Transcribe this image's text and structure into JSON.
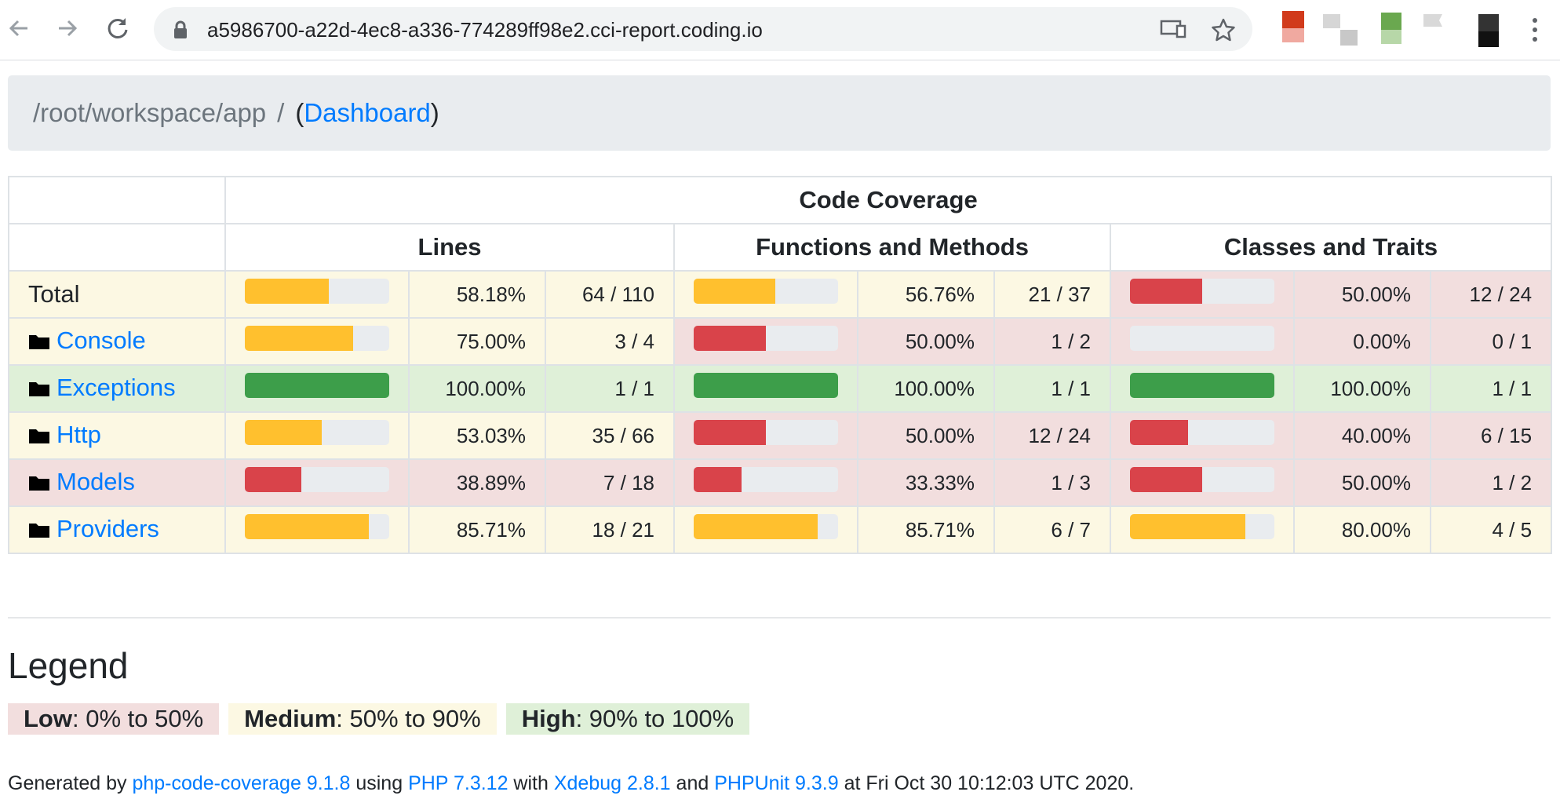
{
  "browser": {
    "url": "a5986700-a22d-4ec8-a336-774289ff98e2.cci-report.coding.io",
    "icons": [
      "back-arrow-icon",
      "forward-arrow-icon",
      "reload-icon",
      "lock-icon",
      "cast-icon",
      "star-icon",
      "menu-icon"
    ]
  },
  "breadcrumb": {
    "path": "/root/workspace/app",
    "separator": "/",
    "open_paren": "(",
    "dashboard": "Dashboard",
    "close_paren": ")"
  },
  "table": {
    "group_header": "Code Coverage",
    "headers": {
      "lines": "Lines",
      "functions": "Functions and Methods",
      "classes": "Classes and Traits"
    },
    "rows": [
      {
        "name": "Total",
        "link": false,
        "lines": {
          "level": "warning",
          "pct": "58.18%",
          "ratio": "64 / 110",
          "value": 58.18
        },
        "functions": {
          "level": "warning",
          "pct": "56.76%",
          "ratio": "21 / 37",
          "value": 56.76
        },
        "classes": {
          "level": "danger",
          "pct": "50.00%",
          "ratio": "12 / 24",
          "value": 50.0
        }
      },
      {
        "name": "Console",
        "link": true,
        "lines": {
          "level": "warning",
          "pct": "75.00%",
          "ratio": "3 / 4",
          "value": 75.0
        },
        "functions": {
          "level": "danger",
          "pct": "50.00%",
          "ratio": "1 / 2",
          "value": 50.0
        },
        "classes": {
          "level": "danger",
          "pct": "0.00%",
          "ratio": "0 / 1",
          "value": 0
        }
      },
      {
        "name": "Exceptions",
        "link": true,
        "lines": {
          "level": "success",
          "pct": "100.00%",
          "ratio": "1 / 1",
          "value": 100
        },
        "functions": {
          "level": "success",
          "pct": "100.00%",
          "ratio": "1 / 1",
          "value": 100
        },
        "classes": {
          "level": "success",
          "pct": "100.00%",
          "ratio": "1 / 1",
          "value": 100
        }
      },
      {
        "name": "Http",
        "link": true,
        "lines": {
          "level": "warning",
          "pct": "53.03%",
          "ratio": "35 / 66",
          "value": 53.03
        },
        "functions": {
          "level": "danger",
          "pct": "50.00%",
          "ratio": "12 / 24",
          "value": 50.0
        },
        "classes": {
          "level": "danger",
          "pct": "40.00%",
          "ratio": "6 / 15",
          "value": 40.0
        }
      },
      {
        "name": "Models",
        "link": true,
        "lines": {
          "level": "danger",
          "pct": "38.89%",
          "ratio": "7 / 18",
          "value": 38.89
        },
        "functions": {
          "level": "danger",
          "pct": "33.33%",
          "ratio": "1 / 3",
          "value": 33.33
        },
        "classes": {
          "level": "danger",
          "pct": "50.00%",
          "ratio": "1 / 2",
          "value": 50.0
        }
      },
      {
        "name": "Providers",
        "link": true,
        "lines": {
          "level": "warning",
          "pct": "85.71%",
          "ratio": "18 / 21",
          "value": 85.71
        },
        "functions": {
          "level": "warning",
          "pct": "85.71%",
          "ratio": "6 / 7",
          "value": 85.71
        },
        "classes": {
          "level": "warning",
          "pct": "80.00%",
          "ratio": "4 / 5",
          "value": 80.0
        }
      }
    ]
  },
  "legend": {
    "title": "Legend",
    "low_label": "Low",
    "low_range": ": 0% to 50%",
    "medium_label": "Medium",
    "medium_range": ": 50% to 90%",
    "high_label": "High",
    "high_range": ": 90% to 100%"
  },
  "footer": {
    "t1": "Generated by ",
    "link1": "php-code-coverage 9.1.8",
    "t2": " using ",
    "link2": "PHP 7.3.12",
    "t3": " with ",
    "link3": "Xdebug 2.8.1",
    "t4": " and ",
    "link4": "PHPUnit 9.3.9",
    "t5": " at Fri Oct 30 10:12:03 UTC 2020."
  },
  "colors": {
    "link": "#007bff",
    "low_bg": "#f2dede",
    "medium_bg": "#fcf8e3",
    "high_bg": "#dff0d8",
    "bar_danger": "#d9434a",
    "bar_warning": "#ffc02e",
    "bar_success": "#3d9e4a"
  }
}
